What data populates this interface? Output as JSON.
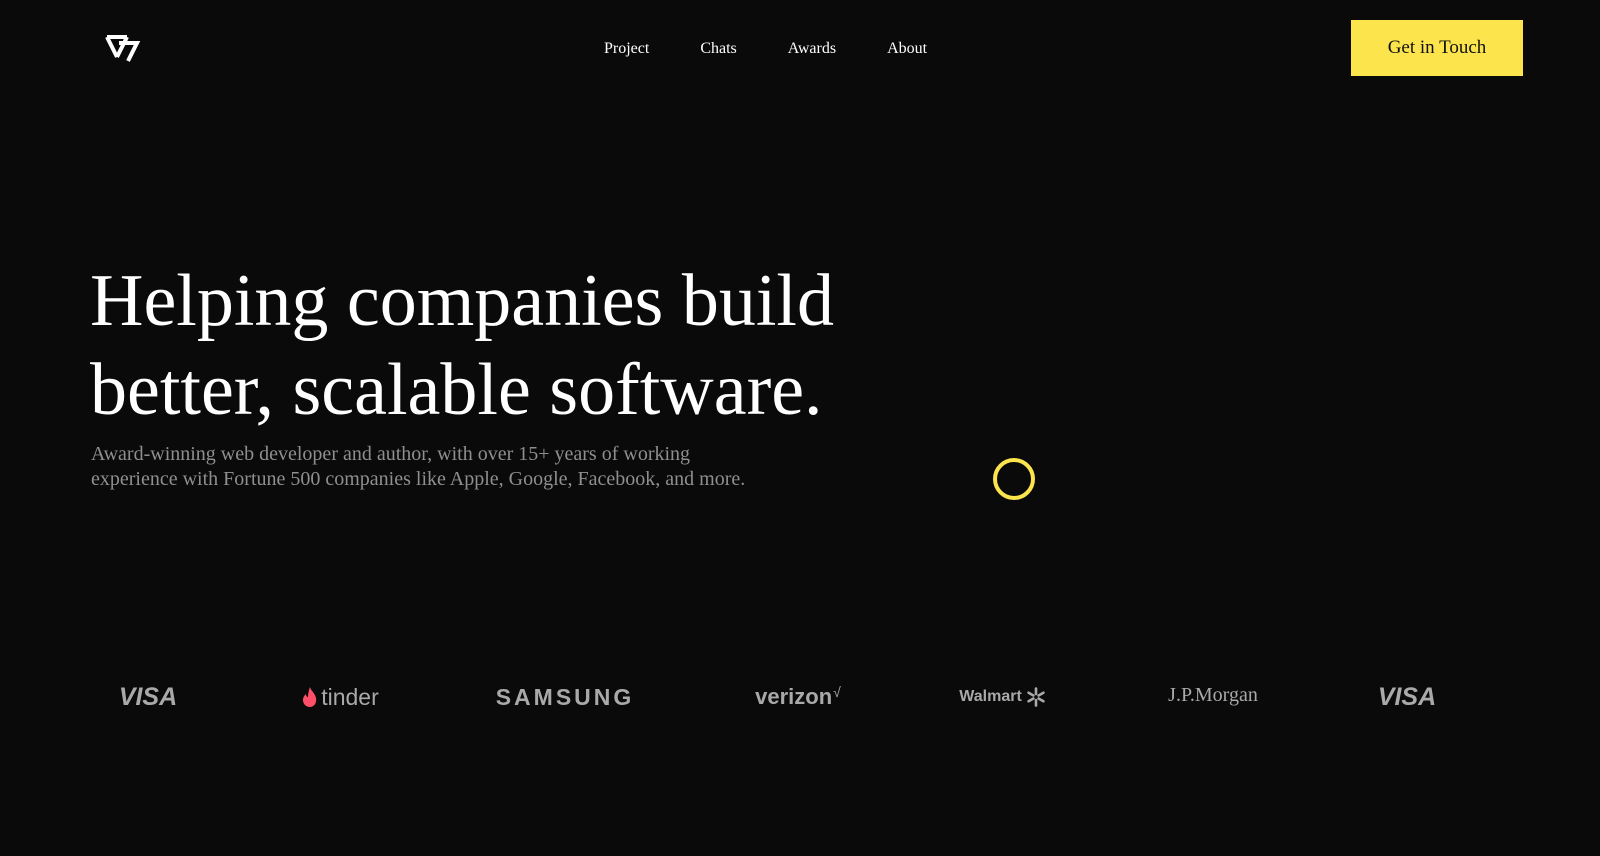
{
  "header": {
    "logo_icon": "triangle-chevron-logo-icon",
    "nav": [
      {
        "label": "Project"
      },
      {
        "label": "Chats"
      },
      {
        "label": "Awards"
      },
      {
        "label": "About"
      }
    ],
    "cta_label": "Get in Touch"
  },
  "hero": {
    "title": "Helping companies build better, scalable software.",
    "subtitle": "Award-winning web developer and author, with over 15+ years of working experience with Fortune 500 companies like Apple, Google, Facebook, and more."
  },
  "clients": [
    {
      "name": "VISA"
    },
    {
      "name": "tinder",
      "icon": "flame-icon"
    },
    {
      "name": "SAMSUNG"
    },
    {
      "name": "verizon",
      "mark": "√"
    },
    {
      "name": "Walmart",
      "icon": "spark-icon"
    },
    {
      "name": "J.P.Morgan"
    },
    {
      "name": "VISA"
    }
  ],
  "colors": {
    "background": "#0a0a0a",
    "accent": "#fce44d",
    "text": "#ffffff",
    "muted_text": "#8f8f8f",
    "logo_gray": "#a9a9a9",
    "tinder_flame": "#fd5068"
  }
}
